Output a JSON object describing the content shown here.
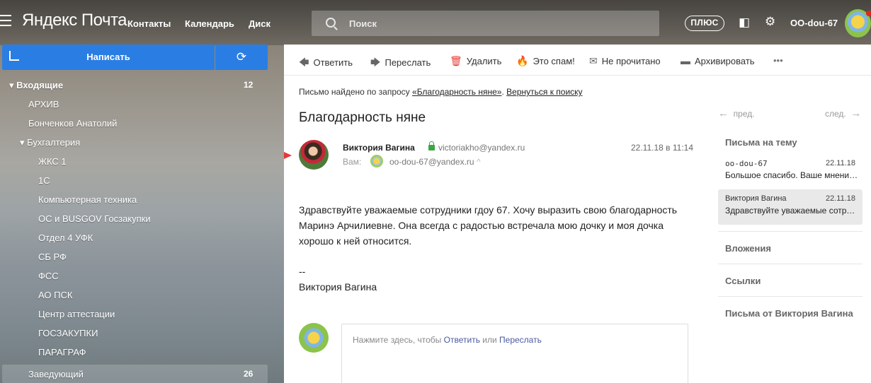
{
  "header": {
    "logo": "Яндекс Почта",
    "nav": [
      "Контакты",
      "Календарь",
      "Диск"
    ],
    "search_placeholder": "Поиск",
    "plus_label": "ПЛЮС",
    "username": "OO-dou-67"
  },
  "sidebar": {
    "compose_label": "Написать",
    "folders": [
      {
        "label": "▾ Входящие",
        "count": "12"
      },
      {
        "label": "АРХИВ"
      },
      {
        "label": "Бонченков Анатолий"
      },
      {
        "label": "▾ Бухгалтерия"
      },
      {
        "label": "ЖКС 1"
      },
      {
        "label": "1С"
      },
      {
        "label": "Компьютерная техника"
      },
      {
        "label": "ОС и BUSGOV Госзакупки"
      },
      {
        "label": "Отдел 4 УФК"
      },
      {
        "label": "СБ РФ"
      },
      {
        "label": "ФСС"
      },
      {
        "label": "АО ПСК"
      },
      {
        "label": "Центр аттестации"
      },
      {
        "label": "ГОСЗАКУПКИ"
      },
      {
        "label": "ПАРАГРАФ"
      },
      {
        "label": "Заведующий",
        "count": "26"
      }
    ]
  },
  "toolbar": {
    "reply": "Ответить",
    "forward": "Переслать",
    "delete": "Удалить",
    "spam": "Это спам!",
    "unread": "Не прочитано",
    "archive": "Архивировать",
    "more": "•••"
  },
  "message": {
    "found_prefix": "Письмо найдено по запросу ",
    "found_query": "«Благодарность няне»",
    "found_sep": ". ",
    "back_to_search": "Вернуться к поиску",
    "subject": "Благодарность няне",
    "sender_name": "Виктория Вагина",
    "sender_email": "victoriakho@yandex.ru",
    "date": "22.11.18 в 11:14",
    "to_label": "Вам:",
    "to_email": "oo-dou-67@yandex.ru",
    "to_chevron": "^",
    "body": "Здравствуйте уважаемые сотрудники гдоу 67. Хочу выразить свою благодарность Маринэ Арчилиевне. Она всегда с радостью встречала мою дочку и моя дочка хорошо к ней относится.",
    "sig_dash": "--",
    "sig_name": "Виктория Вагина"
  },
  "reply_box": {
    "prefix": "Нажмите здесь, чтобы ",
    "reply": "Ответить",
    "or": " или ",
    "forward": "Переслать"
  },
  "right": {
    "prev": "пред.",
    "next": "след.",
    "thread_header": "Письма на тему",
    "threads": [
      {
        "from": "oo-dou-67",
        "date": "22.11.18",
        "snippet": "Большое спасибо. Ваше мнение для нас очень важно"
      },
      {
        "from": "Виктория Вагина",
        "date": "22.11.18",
        "snippet": "Здравствуйте уважаемые сотрудники"
      }
    ],
    "attachments": "Вложения",
    "links": "Ссылки",
    "from_sender": "Письма от Виктория Вагина"
  }
}
